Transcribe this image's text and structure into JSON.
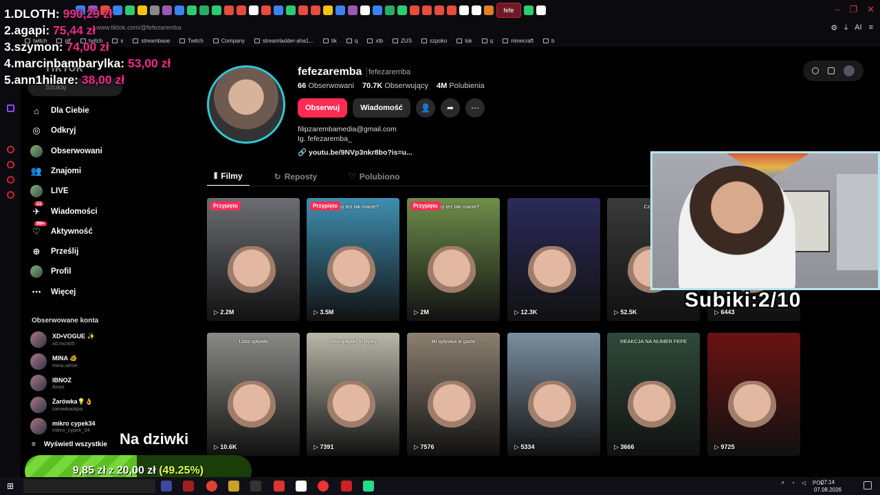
{
  "browser": {
    "url": "www.tiktok.com/@fefezaremba",
    "active_tab_label": "fefe",
    "tab_colors": [
      "#3b82f6",
      "#9b59b6",
      "#e74c3c",
      "#3b82f6",
      "#2ecc71",
      "#f1c40f",
      "#888",
      "#9b59b6",
      "#3b82f6",
      "#2ecc71",
      "#27ae60",
      "#2ecc71",
      "#e74c3c",
      "#e74c3c",
      "#fff",
      "#e74c3c",
      "#3b82f6",
      "#2ecc71",
      "#e74c3c",
      "#e74c3c",
      "#f1c40f",
      "#3b82f6",
      "#9b59b6",
      "#fff",
      "#3b82f6",
      "#27ae60",
      "#2ecc71",
      "#e74c3c",
      "#e74c3c",
      "#e74c3c",
      "#e74c3c",
      "#fff",
      "#fff",
      "#e67e22",
      "#2ecc71",
      "#fff"
    ],
    "bookmarks": [
      "twitch",
      "gif",
      "twitch",
      "s",
      "streambase",
      "Twitch",
      "Company",
      "streamladder-aha1...",
      "tik",
      "q",
      "xtb",
      "ZUS",
      "szpoko",
      "lok",
      "q",
      "minecraft",
      "b"
    ]
  },
  "leaderboard": [
    {
      "rank": "1.",
      "name": "DLOTH:",
      "amount": "990,29 zł"
    },
    {
      "rank": "2.",
      "name": "agapi:",
      "amount": "75,44 zł"
    },
    {
      "rank": "3.",
      "name": "szymon:",
      "amount": "74,00 zł"
    },
    {
      "rank": "4.",
      "name": "marcinbambarylka:",
      "amount": "53,00 zł"
    },
    {
      "rank": "5.",
      "name": "ann1hilare:",
      "amount": "38,00 zł"
    }
  ],
  "sidebar": {
    "logo": "TikTok",
    "search_placeholder": "Szukaj",
    "nav": [
      {
        "label": "Dla Ciebie",
        "icon": "home-icon"
      },
      {
        "label": "Odkryj",
        "icon": "compass-icon"
      },
      {
        "label": "Obserwowani",
        "icon": "avatar"
      },
      {
        "label": "Znajomi",
        "icon": "friends-icon"
      },
      {
        "label": "LIVE",
        "icon": "live-icon"
      },
      {
        "label": "Wiadomości",
        "icon": "messages-icon",
        "badge": "11"
      },
      {
        "label": "Aktywność",
        "icon": "activity-icon",
        "badge": "99+"
      },
      {
        "label": "Prześlij",
        "icon": "upload-icon"
      },
      {
        "label": "Profil",
        "icon": "profile-icon"
      },
      {
        "label": "Więcej",
        "icon": "more-icon"
      }
    ],
    "followed_header": "Obserwowane konta",
    "followed": [
      {
        "name": "XD•VOGUE ✨",
        "handle": "xd.mcn05"
      },
      {
        "name": "MINA 🐠",
        "handle": "mina.verse"
      },
      {
        "name": "IBNOZ",
        "handle": "ibnoz"
      },
      {
        "name": "Żarówka💡👌",
        "handle": "zarowkaokpa"
      },
      {
        "name": "mikro cypek34",
        "handle": "mikro_cypek_34"
      }
    ],
    "see_all": "Wyświetl wszystkie"
  },
  "profile": {
    "username": "fefezaremba",
    "nickname": "fefezaremba",
    "following_count": "66",
    "following_label": "Obserwowani",
    "followers_count": "70.7K",
    "followers_label": "Obserwujący",
    "likes_count": "4M",
    "likes_label": "Polubienia",
    "follow_label": "Obserwuj",
    "message_label": "Wiadomość",
    "bio_email": "filipzarembamedia@gmail.com",
    "bio_ig": "Ig. fefezaremba_",
    "bio_link": "youtu.be/9NVp3nkr8bo?is=u..."
  },
  "tabs": [
    {
      "label": "Filmy",
      "active": true
    },
    {
      "label": "Reposty",
      "active": false
    },
    {
      "label": "Polubiono",
      "active": false
    }
  ],
  "videos": [
    {
      "views": "2.2M",
      "pinned": "Przypięto",
      "caption": "",
      "bg": "#6b6d72"
    },
    {
      "views": "3.5M",
      "pinned": "Przypięto",
      "caption": "Czy wy też tak macie?",
      "bg": "#3f8fb0"
    },
    {
      "views": "2M",
      "pinned": "Przypięto",
      "caption": "Czy wy też tak macie?",
      "bg": "#6f8e4a"
    },
    {
      "views": "12.3K",
      "pinned": "",
      "caption": "",
      "bg": "#2b2a5a"
    },
    {
      "views": "52.5K",
      "pinned": "",
      "caption": "Czy wy t",
      "bg": "#3a3a3a"
    },
    {
      "views": "6443",
      "pinned": "",
      "caption": "",
      "bg": "#2b2b2b"
    },
    {
      "views": "10.6K",
      "pinned": "",
      "caption": "Lista spływki",
      "bg": "#8a8a85"
    },
    {
      "views": "7391",
      "pinned": "",
      "caption": "lista spływki tu lepiej",
      "bg": "#b9b7a8"
    },
    {
      "views": "7576",
      "pinned": "",
      "caption": "Mi spływka w gazie",
      "bg": "#8c8070"
    },
    {
      "views": "5334",
      "pinned": "",
      "caption": "",
      "bg": "#7a8fa0"
    },
    {
      "views": "3666",
      "pinned": "",
      "caption": "REAKCJA NA NUMER FEFE",
      "bg": "#2f4a3a"
    },
    {
      "views": "9725",
      "pinned": "",
      "caption": "",
      "bg": "#6a1212"
    }
  ],
  "overlay": {
    "subs_text": "Subiki:2/10",
    "alert_text": "Na dziwki",
    "goal_current": "9,85 zł",
    "goal_of": "z",
    "goal_target": "20,00 zł",
    "goal_percent": "(49.25%)",
    "goal_fraction": 0.4925
  },
  "taskbar": {
    "time": "07:14",
    "date": "07.08.2026",
    "lang": "POL"
  }
}
